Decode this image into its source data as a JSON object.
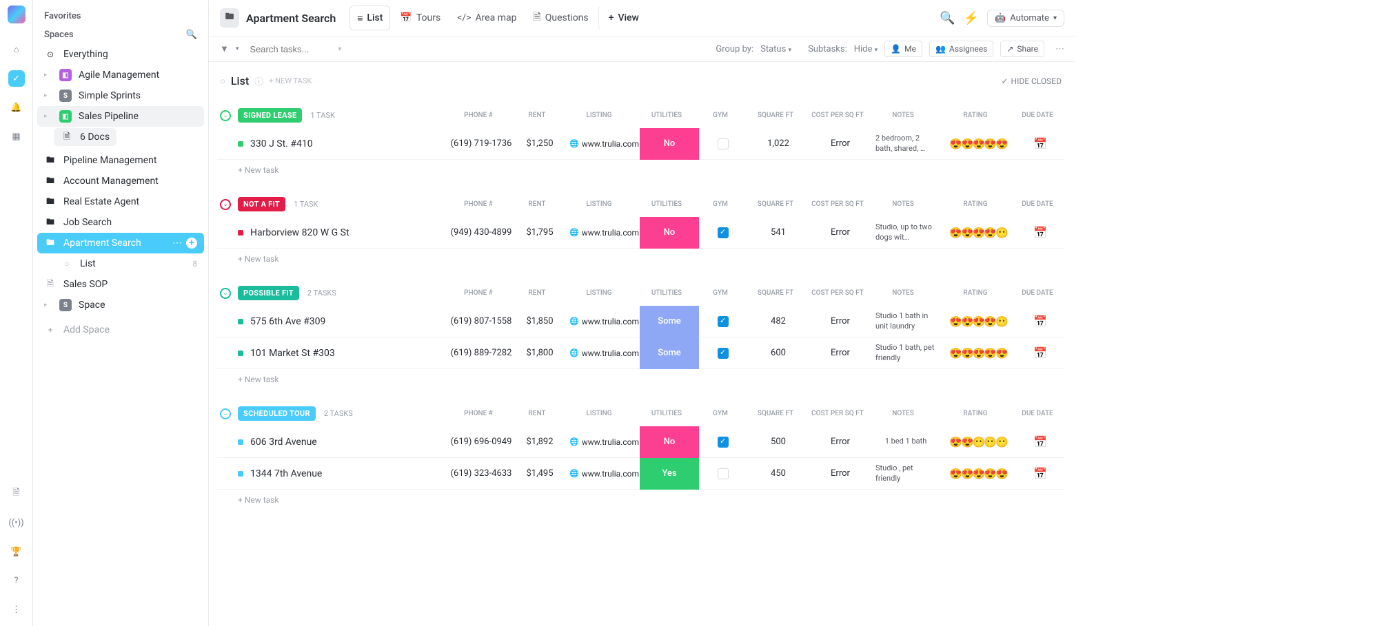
{
  "sidebar": {
    "favorites": "Favorites",
    "spaces": "Spaces",
    "everything": "Everything",
    "items": [
      {
        "label": "Agile Management",
        "color": "#b660e0"
      },
      {
        "label": "Simple Sprints",
        "letter": "S",
        "color": "#7c828d"
      },
      {
        "label": "Sales Pipeline",
        "color": "#2ecd6f",
        "active": true,
        "docs": "6 Docs",
        "sub": [
          {
            "label": "Pipeline Management"
          },
          {
            "label": "Account Management"
          },
          {
            "label": "Real Estate Agent"
          },
          {
            "label": "Job Search"
          },
          {
            "label": "Apartment Search",
            "active": true,
            "children": [
              {
                "label": "List",
                "count": "8"
              }
            ]
          }
        ],
        "extra": {
          "label": "Sales SOP"
        }
      },
      {
        "label": "Space",
        "letter": "S",
        "color": "#7c828d"
      }
    ],
    "add_space": "Add Space"
  },
  "top": {
    "title": "Apartment Search",
    "tabs": [
      {
        "label": "List",
        "icon": "≡",
        "active": true
      },
      {
        "label": "Tours",
        "icon": "📅"
      },
      {
        "label": "Area map",
        "icon": "</>"
      },
      {
        "label": "Questions",
        "icon": "📄"
      },
      {
        "label": "View",
        "icon": "+"
      }
    ],
    "automate": "Automate"
  },
  "filter": {
    "placeholder": "Search tasks...",
    "groupby": "Group by:",
    "status": "Status",
    "subtasks": "Subtasks:",
    "hide": "Hide",
    "me": "Me",
    "assignees": "Assignees",
    "share": "Share"
  },
  "list": {
    "title": "List",
    "new_task": "+ NEW TASK",
    "hide_closed": "HIDE CLOSED",
    "columns": {
      "phone": "PHONE #",
      "rent": "RENT",
      "listing": "LISTING",
      "utilities": "UTILITIES",
      "gym": "GYM",
      "sqft": "SQUARE FT",
      "cost": "COST PER SQ FT",
      "notes": "NOTES",
      "rating": "RATING",
      "due": "DUE DATE"
    },
    "add_task": "+ New task"
  },
  "groups": [
    {
      "status": "SIGNED LEASE",
      "color": "#2ecd6f",
      "circ": "#2ecd6f",
      "count": "1 TASK",
      "rows": [
        {
          "name": "330 J St. #410",
          "dot": "#2ecd6f",
          "phone": "(619) 719-1736",
          "rent": "$1,250",
          "listing": "www.trulia.com",
          "util": "No",
          "util_color": "#fd3f92",
          "gym": false,
          "sqft": "1,022",
          "cost": "Error",
          "notes": "2 bedroom, 2 bath, shared, …",
          "rating": "😍😍😍😍😍"
        }
      ]
    },
    {
      "status": "NOT A FIT",
      "color": "#e11d48",
      "circ": "#e11d48",
      "count": "1 TASK",
      "rows": [
        {
          "name": "Harborview 820 W G St",
          "dot": "#e11d48",
          "phone": "(949) 430-4899",
          "rent": "$1,795",
          "listing": "www.trulia.com",
          "util": "No",
          "util_color": "#fd3f92",
          "gym": true,
          "sqft": "541",
          "cost": "Error",
          "notes": "Studio, up to two dogs wit…",
          "rating": "😍😍😍😍😶"
        }
      ]
    },
    {
      "status": "POSSIBLE FIT",
      "color": "#1bbc9c",
      "circ": "#1bbc9c",
      "count": "2 TASKS",
      "rows": [
        {
          "name": "575 6th Ave #309",
          "dot": "#1bbc9c",
          "phone": "(619) 807-1558",
          "rent": "$1,850",
          "listing": "www.trulia.com",
          "util": "Some",
          "util_color": "#8fa8f6",
          "gym": true,
          "sqft": "482",
          "cost": "Error",
          "notes": "Studio 1 bath in unit laundry",
          "rating": "😍😍😍😍😶"
        },
        {
          "name": "101 Market St #303",
          "dot": "#1bbc9c",
          "phone": "(619) 889-7282",
          "rent": "$1,800",
          "listing": "www.trulia.com",
          "util": "Some",
          "util_color": "#8fa8f6",
          "gym": true,
          "sqft": "600",
          "cost": "Error",
          "notes": "Studio 1 bath, pet friendly",
          "rating": "😍😍😍😍😍"
        }
      ]
    },
    {
      "status": "SCHEDULED TOUR",
      "color": "#49ccf9",
      "circ": "#49ccf9",
      "count": "2 TASKS",
      "rows": [
        {
          "name": "606 3rd Avenue",
          "dot": "#49ccf9",
          "phone": "(619) 696-0949",
          "rent": "$1,892",
          "listing": "www.trulia.com",
          "util": "No",
          "util_color": "#fd3f92",
          "gym": true,
          "sqft": "500",
          "cost": "Error",
          "notes": "1 bed 1 bath",
          "rating": "😍😍😶😶😶"
        },
        {
          "name": "1344 7th Avenue",
          "dot": "#49ccf9",
          "phone": "(619) 323-4633",
          "rent": "$1,495",
          "listing": "www.trulia.com",
          "util": "Yes",
          "util_color": "#2ecd6f",
          "gym": false,
          "sqft": "450",
          "cost": "Error",
          "notes": "Studio , pet friendly",
          "rating": "😍😍😍😍😍"
        }
      ]
    }
  ]
}
